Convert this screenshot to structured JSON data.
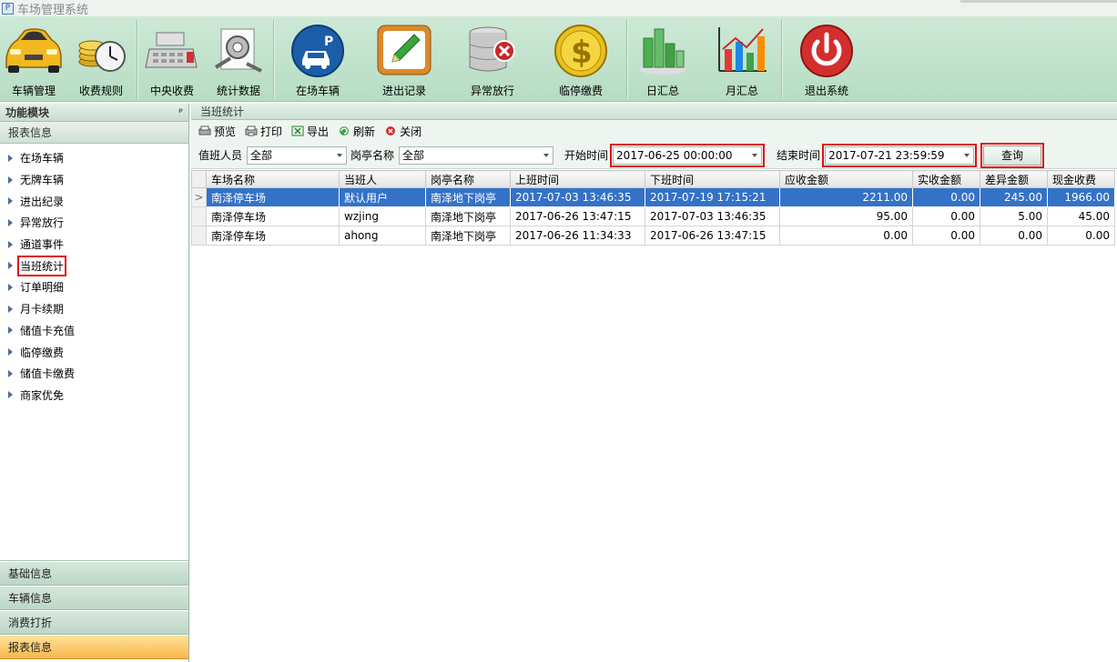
{
  "window": {
    "title": "车场管理系统"
  },
  "toolbar": {
    "buttons": [
      {
        "label": "车辆管理",
        "icon": "sports-car-icon"
      },
      {
        "label": "收费规则",
        "icon": "coins-clock-icon"
      },
      {
        "label": "中央收费",
        "icon": "cash-register-icon"
      },
      {
        "label": "统计数据",
        "icon": "gear-document-icon"
      },
      {
        "label": "在场车辆",
        "icon": "parking-car-icon"
      },
      {
        "label": "进出记录",
        "icon": "notepad-pencil-icon"
      },
      {
        "label": "异常放行",
        "icon": "database-error-icon"
      },
      {
        "label": "临停缴费",
        "icon": "dollar-coin-icon"
      },
      {
        "label": "日汇总",
        "icon": "bar-blocks-icon"
      },
      {
        "label": "月汇总",
        "icon": "bar-chart-icon"
      },
      {
        "label": "退出系统",
        "icon": "power-icon"
      }
    ]
  },
  "left": {
    "header": "功能模块",
    "pin": "ᵖ",
    "group": "报表信息",
    "items": [
      "在场车辆",
      "无牌车辆",
      "进出纪录",
      "异常放行",
      "通道事件",
      "当班统计",
      "订单明细",
      "月卡续期",
      "储值卡充值",
      "临停缴费",
      "储值卡缴费",
      "商家优免"
    ],
    "categories": [
      "基础信息",
      "车辆信息",
      "消费打折",
      "报表信息"
    ]
  },
  "main": {
    "title": "当班统计",
    "actions": [
      "预览",
      "打印",
      "导出",
      "刷新",
      "关闭"
    ],
    "filter": {
      "staff_label": "值班人员",
      "staff_value": "全部",
      "booth_label": "岗亭名称",
      "booth_value": "全部",
      "start_label": "开始时间",
      "start_value": "2017-06-25 00:00:00",
      "end_label": "结束时间",
      "end_value": "2017-07-21 23:59:59",
      "query_label": "查询"
    },
    "columns": [
      "车场名称",
      "当班人",
      "岗亭名称",
      "上班时间",
      "下班时间",
      "应收金额",
      "实收金额",
      "差异金额",
      "现金收费"
    ],
    "rows": [
      [
        "南泽停车场",
        "默认用户",
        "南泽地下岗亭",
        "2017-07-03 13:46:35",
        "2017-07-19 17:15:21",
        "2211.00",
        "0.00",
        "245.00",
        "1966.00"
      ],
      [
        "南泽停车场",
        "wzjing",
        "南泽地下岗亭",
        "2017-06-26 13:47:15",
        "2017-07-03 13:46:35",
        "95.00",
        "0.00",
        "5.00",
        "45.00"
      ],
      [
        "南泽停车场",
        "ahong",
        "南泽地下岗亭",
        "2017-06-26 11:34:33",
        "2017-06-26 13:47:15",
        "0.00",
        "0.00",
        "0.00",
        "0.00"
      ]
    ],
    "row_indicator": ">"
  }
}
